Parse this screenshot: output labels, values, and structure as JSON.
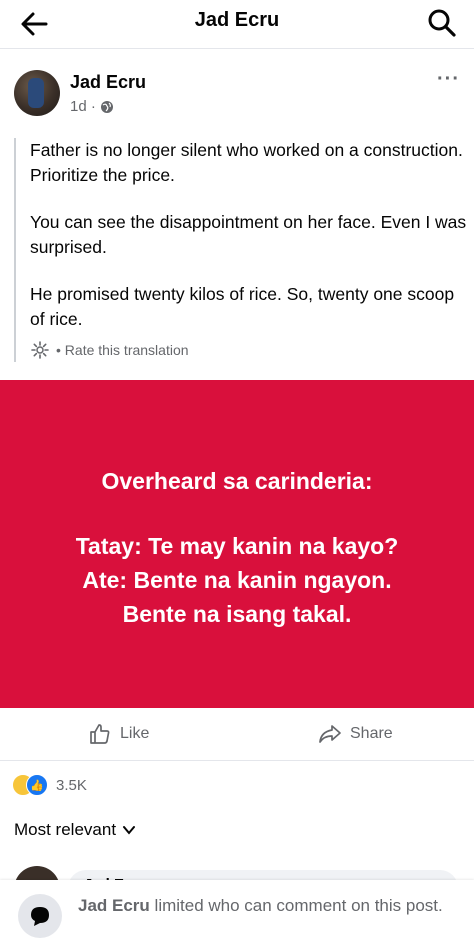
{
  "header": {
    "title": "Jad Ecru",
    "back_icon": "arrow-left-icon",
    "search_icon": "search-icon"
  },
  "post": {
    "author": "Jad Ecru",
    "time": "1d ·",
    "privacy_icon": "globe-icon",
    "more_icon": "more-dots-icon",
    "more": "···",
    "translation": [
      "Father is no longer silent who worked on a construction. Prioritize the price.",
      "You can see the disappointment on her face. Even I was surprised.",
      "He promised twenty kilos of rice. So, twenty one scoop of rice."
    ],
    "rate_label": "• Rate this translation",
    "image_text": {
      "line1": "Overheard sa carinderia:",
      "line2": "Tatay: Te may kanin na kayo?",
      "line3": "Ate: Bente na kanin ngayon.",
      "line4": "Bente na isang takal."
    },
    "image_bg": "#d9103c"
  },
  "actions": {
    "like": "Like",
    "share": "Share"
  },
  "reactions": {
    "count": "3.5K",
    "types": [
      "sad",
      "like"
    ]
  },
  "comments": {
    "sort_label": "Most relevant",
    "peek_name": "Jad Ecru"
  },
  "notice": {
    "name": "Jad Ecru",
    "text": "limited who can comment on this post."
  }
}
